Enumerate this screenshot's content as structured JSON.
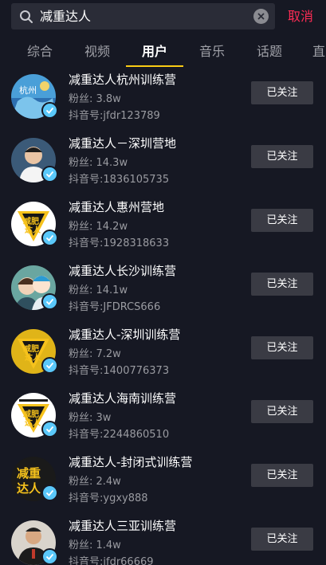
{
  "search": {
    "query": "减重达人",
    "cancel_label": "取消"
  },
  "tabs": [
    {
      "label": "综合"
    },
    {
      "label": "视频"
    },
    {
      "label": "用户"
    },
    {
      "label": "音乐"
    },
    {
      "label": "话题"
    },
    {
      "label": "直"
    }
  ],
  "active_tab": "用户",
  "colors": {
    "background": "#161823",
    "accent_underline": "#facc15",
    "cancel": "#fe2c55",
    "verified": "#5ac8fa",
    "button_bg": "#3a3b44"
  },
  "users": [
    {
      "name": "减重达人杭州训练营",
      "fans": "粉丝: 3.8w",
      "id": "抖音号:jfdr123789",
      "button": "已关注"
    },
    {
      "name": "减重达人－深圳营地",
      "fans": "粉丝: 14.3w",
      "id": "抖音号:1836105735",
      "button": "已关注"
    },
    {
      "name": "减重达人惠州营地",
      "fans": "粉丝: 14.2w",
      "id": "抖音号:1928318633",
      "button": "已关注"
    },
    {
      "name": "减重达人长沙训练营",
      "fans": "粉丝: 14.1w",
      "id": "抖音号:JFDRCS666",
      "button": "已关注"
    },
    {
      "name": "减重达人-深圳训练营",
      "fans": "粉丝: 7.2w",
      "id": "抖音号:1400776373",
      "button": "已关注"
    },
    {
      "name": "减重达人海南训练营",
      "fans": "粉丝: 3w",
      "id": "抖音号:2244860510",
      "button": "已关注"
    },
    {
      "name": "减重达人-封闭式训练营",
      "fans": "粉丝: 2.4w",
      "id": "抖音号:ygxy888",
      "button": "已关注"
    },
    {
      "name": "减重达人三亚训练营",
      "fans": "粉丝: 1.4w",
      "id": "抖音号:jfdr66669",
      "button": "已关注"
    }
  ],
  "avatar_logo_text": [
    "减肥",
    "达人"
  ],
  "avatar_text_logo": [
    "减重",
    "达人"
  ]
}
